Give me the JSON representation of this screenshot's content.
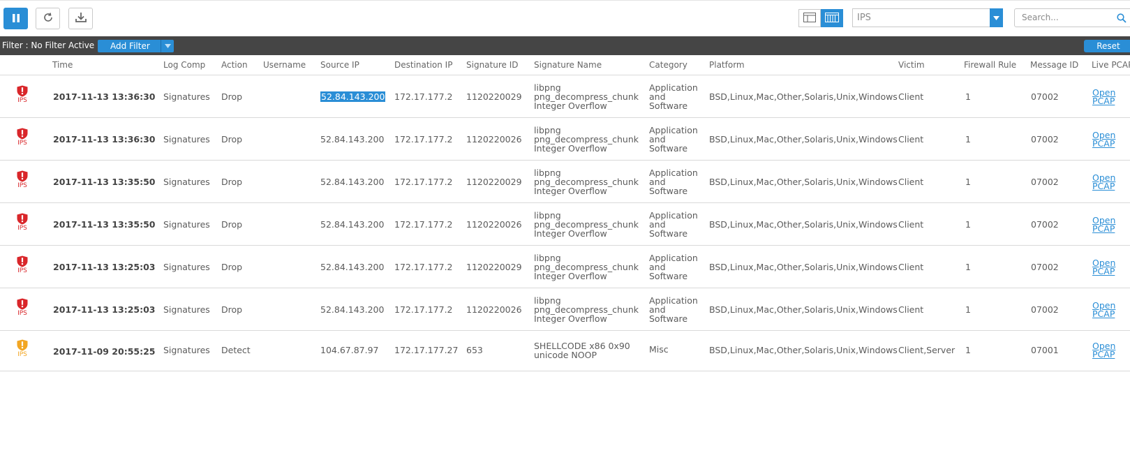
{
  "toolbar": {
    "pause_icon": "pause-icon",
    "refresh_icon": "refresh-icon",
    "download_icon": "download-icon",
    "view_icons": [
      "detail-view-icon",
      "grid-view-icon"
    ],
    "module_select": {
      "value": "IPS"
    },
    "search": {
      "placeholder": "Search..."
    }
  },
  "filter_bar": {
    "label": "Filter : No Filter Active",
    "add_filter": "Add Filter",
    "reset": "Reset"
  },
  "table": {
    "columns": [
      "Time",
      "Log Comp",
      "Action",
      "Username",
      "Source IP",
      "Destination IP",
      "Signature ID",
      "Signature Name",
      "Category",
      "Platform",
      "Victim",
      "Firewall Rule",
      "Message ID",
      "Live PCAP"
    ],
    "rows": [
      {
        "badge": "IPS",
        "severity": "high",
        "time": "2017-11-13 13:36:30",
        "log_comp": "Signatures",
        "action": "Drop",
        "username": "",
        "source_ip": "52.84.143.200",
        "dest_ip": "172.17.177.2",
        "sig_id": "1120220029",
        "sig_name": [
          "libpng",
          "png_decompress_chunk",
          "Integer Overflow"
        ],
        "category": [
          "Application",
          "and",
          "Software"
        ],
        "platform": "BSD,Linux,Mac,Other,Solaris,Unix,Windows",
        "victim": "Client",
        "fw_rule": "1",
        "msg_id": "07002",
        "pcap": "Open PCAP"
      },
      {
        "badge": "IPS",
        "severity": "high",
        "time": "2017-11-13 13:36:30",
        "log_comp": "Signatures",
        "action": "Drop",
        "username": "",
        "source_ip": "52.84.143.200",
        "dest_ip": "172.17.177.2",
        "sig_id": "1120220026",
        "sig_name": [
          "libpng",
          "png_decompress_chunk",
          "Integer Overflow"
        ],
        "category": [
          "Application",
          "and",
          "Software"
        ],
        "platform": "BSD,Linux,Mac,Other,Solaris,Unix,Windows",
        "victim": "Client",
        "fw_rule": "1",
        "msg_id": "07002",
        "pcap": "Open PCAP"
      },
      {
        "badge": "IPS",
        "severity": "high",
        "time": "2017-11-13 13:35:50",
        "log_comp": "Signatures",
        "action": "Drop",
        "username": "",
        "source_ip": "52.84.143.200",
        "dest_ip": "172.17.177.2",
        "sig_id": "1120220029",
        "sig_name": [
          "libpng",
          "png_decompress_chunk",
          "Integer Overflow"
        ],
        "category": [
          "Application",
          "and",
          "Software"
        ],
        "platform": "BSD,Linux,Mac,Other,Solaris,Unix,Windows",
        "victim": "Client",
        "fw_rule": "1",
        "msg_id": "07002",
        "pcap": "Open PCAP"
      },
      {
        "badge": "IPS",
        "severity": "high",
        "time": "2017-11-13 13:35:50",
        "log_comp": "Signatures",
        "action": "Drop",
        "username": "",
        "source_ip": "52.84.143.200",
        "dest_ip": "172.17.177.2",
        "sig_id": "1120220026",
        "sig_name": [
          "libpng",
          "png_decompress_chunk",
          "Integer Overflow"
        ],
        "category": [
          "Application",
          "and",
          "Software"
        ],
        "platform": "BSD,Linux,Mac,Other,Solaris,Unix,Windows",
        "victim": "Client",
        "fw_rule": "1",
        "msg_id": "07002",
        "pcap": "Open PCAP"
      },
      {
        "badge": "IPS",
        "severity": "high",
        "time": "2017-11-13 13:25:03",
        "log_comp": "Signatures",
        "action": "Drop",
        "username": "",
        "source_ip": "52.84.143.200",
        "dest_ip": "172.17.177.2",
        "sig_id": "1120220029",
        "sig_name": [
          "libpng",
          "png_decompress_chunk",
          "Integer Overflow"
        ],
        "category": [
          "Application",
          "and",
          "Software"
        ],
        "platform": "BSD,Linux,Mac,Other,Solaris,Unix,Windows",
        "victim": "Client",
        "fw_rule": "1",
        "msg_id": "07002",
        "pcap": "Open PCAP"
      },
      {
        "badge": "IPS",
        "severity": "high",
        "time": "2017-11-13 13:25:03",
        "log_comp": "Signatures",
        "action": "Drop",
        "username": "",
        "source_ip": "52.84.143.200",
        "dest_ip": "172.17.177.2",
        "sig_id": "1120220026",
        "sig_name": [
          "libpng",
          "png_decompress_chunk",
          "Integer Overflow"
        ],
        "category": [
          "Application",
          "and",
          "Software"
        ],
        "platform": "BSD,Linux,Mac,Other,Solaris,Unix,Windows",
        "victim": "Client",
        "fw_rule": "1",
        "msg_id": "07002",
        "pcap": "Open PCAP"
      },
      {
        "badge": "IPS",
        "severity": "medium",
        "time": "2017-11-09 20:55:25",
        "log_comp": "Signatures",
        "action": "Detect",
        "username": "",
        "source_ip": "104.67.87.97",
        "dest_ip": "172.17.177.27",
        "sig_id": "653",
        "sig_name": [
          "SHELLCODE x86 0x90",
          "unicode NOOP"
        ],
        "category": [
          "Misc"
        ],
        "platform": "BSD,Linux,Mac,Other,Solaris,Unix,Windows",
        "victim": "Client,Server",
        "fw_rule": "1",
        "msg_id": "07001",
        "pcap": "Open PCAP"
      }
    ]
  },
  "colors": {
    "accent": "#2a8ed6",
    "filter_bar_bg": "#454545",
    "severity_high": "#d9262a",
    "severity_medium": "#f2a623"
  }
}
